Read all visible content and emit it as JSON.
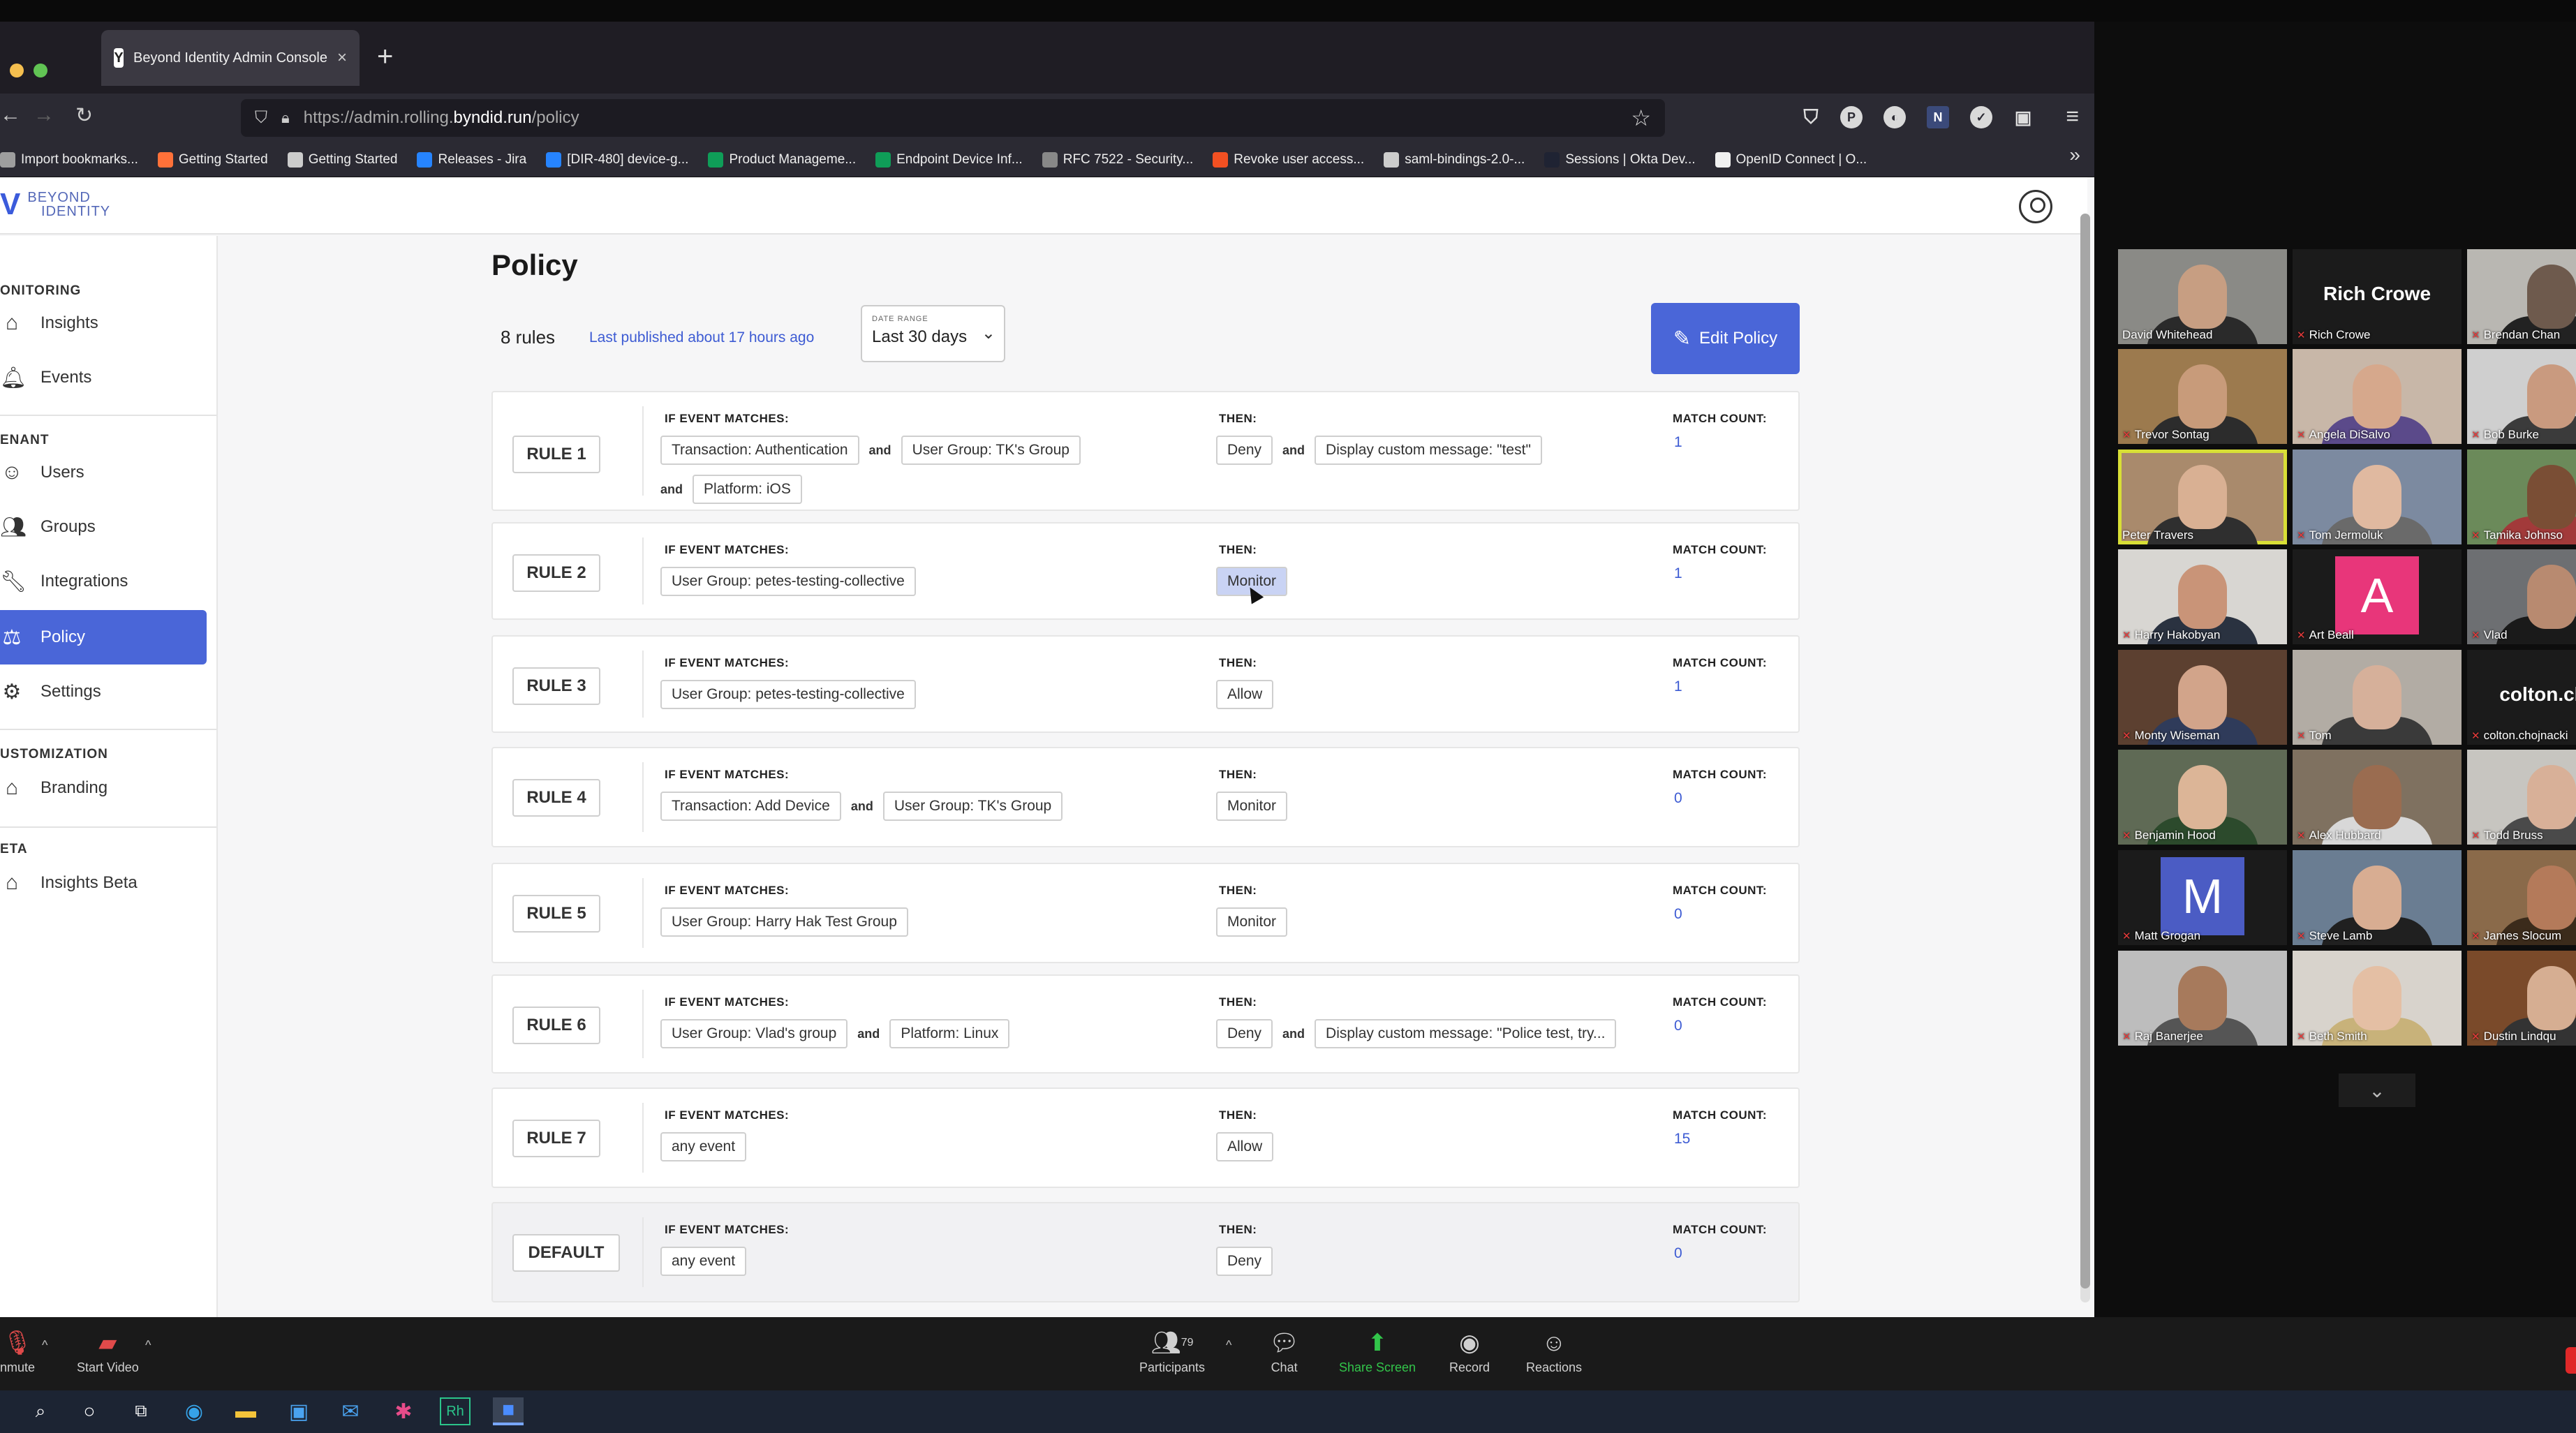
{
  "browser": {
    "tab_title": "Beyond Identity Admin Console",
    "tab_favicon": "Y",
    "tab_close": "×",
    "new_tab": "+",
    "url_prefix": "https://admin.rolling.",
    "url_host": "byndid.run",
    "url_path": "/policy",
    "bookmarks": [
      {
        "label": "Import bookmarks...",
        "icon": "folder-icon",
        "color": "#9e9e9e"
      },
      {
        "label": "Getting Started",
        "icon": "firefox-icon",
        "color": "#ff7139"
      },
      {
        "label": "Getting Started",
        "icon": "globe-icon",
        "color": "#cccccc"
      },
      {
        "label": "Releases - Jira",
        "icon": "jira-icon",
        "color": "#2684ff"
      },
      {
        "label": "[DIR-480] device-g...",
        "icon": "jira-icon",
        "color": "#2684ff"
      },
      {
        "label": "Product Manageme...",
        "icon": "sheet-icon",
        "color": "#0f9d58"
      },
      {
        "label": "Endpoint Device Inf...",
        "icon": "sheet-icon",
        "color": "#0f9d58"
      },
      {
        "label": "RFC 7522 - Security...",
        "icon": "rfc-icon",
        "color": "#888888"
      },
      {
        "label": "Revoke user access...",
        "icon": "windows-icon",
        "color": "#f25022"
      },
      {
        "label": "saml-bindings-2.0-...",
        "icon": "globe-icon",
        "color": "#cccccc"
      },
      {
        "label": "Sessions | Okta Dev...",
        "icon": "okta-icon",
        "color": "#1f2333"
      },
      {
        "label": "OpenID Connect | O...",
        "icon": "oidc-icon",
        "color": "#f0f0f0"
      }
    ]
  },
  "app": {
    "logo_line1": "BEYOND",
    "logo_line2": "IDENTITY",
    "sidebar": {
      "sections": [
        {
          "label": "ONITORING"
        },
        {
          "label": "ENANT"
        },
        {
          "label": "USTOMIZATION"
        },
        {
          "label": "ETA"
        }
      ],
      "items": [
        {
          "label": "Insights",
          "icon": "home-icon"
        },
        {
          "label": "Events",
          "icon": "bell-icon"
        },
        {
          "label": "Users",
          "icon": "user-icon"
        },
        {
          "label": "Groups",
          "icon": "group-icon"
        },
        {
          "label": "Integrations",
          "icon": "wrench-icon"
        },
        {
          "label": "Policy",
          "icon": "gavel-icon",
          "active": true
        },
        {
          "label": "Settings",
          "icon": "gear-icon"
        },
        {
          "label": "Branding",
          "icon": "home-icon"
        },
        {
          "label": "Insights Beta",
          "icon": "home-icon"
        }
      ]
    },
    "page": {
      "title": "Policy",
      "rules_count": "8 rules",
      "last_published": "Last published about 17 hours ago",
      "date_range_label": "DATE RANGE",
      "date_range_value": "Last 30 days",
      "edit_button": "Edit Policy",
      "if_label": "IF EVENT MATCHES:",
      "then_label": "THEN:",
      "match_label": "MATCH COUNT:",
      "and_word": "and"
    },
    "rules": [
      {
        "name": "RULE 1",
        "conditions": [
          "Transaction: Authentication",
          "User Group: TK's Group",
          "Platform: iOS"
        ],
        "actions": [
          "Deny",
          "Display custom message: \"test\""
        ],
        "match_count": "1"
      },
      {
        "name": "RULE 2",
        "conditions": [
          "User Group: petes-testing-collective"
        ],
        "actions": [
          "Monitor"
        ],
        "match_count": "1"
      },
      {
        "name": "RULE 3",
        "conditions": [
          "User Group: petes-testing-collective"
        ],
        "actions": [
          "Allow"
        ],
        "match_count": "1"
      },
      {
        "name": "RULE 4",
        "conditions": [
          "Transaction: Add Device",
          "User Group: TK's Group"
        ],
        "actions": [
          "Monitor"
        ],
        "match_count": "0"
      },
      {
        "name": "RULE 5",
        "conditions": [
          "User Group: Harry Hak Test Group"
        ],
        "actions": [
          "Monitor"
        ],
        "match_count": "0"
      },
      {
        "name": "RULE 6",
        "conditions": [
          "User Group: Vlad's group",
          "Platform: Linux"
        ],
        "actions": [
          "Deny",
          "Display custom message: \"Police test, try..."
        ],
        "match_count": "0"
      },
      {
        "name": "RULE 7",
        "conditions": [
          "any event"
        ],
        "actions": [
          "Allow"
        ],
        "match_count": "15"
      },
      {
        "name": "DEFAULT",
        "conditions": [
          "any event"
        ],
        "actions": [
          "Deny"
        ],
        "match_count": "0"
      }
    ]
  },
  "zoom": {
    "unmute": "nmute",
    "start_video": "Start Video",
    "participants": "Participants",
    "participants_count": "79",
    "chat": "Chat",
    "share_screen": "Share Screen",
    "record": "Record",
    "reactions": "Reactions",
    "participants_grid": [
      {
        "name": "David Whitehead",
        "muted": false,
        "tile": "video",
        "bg": "#8a8a86",
        "skin": "#c79e82",
        "shirt": "#2a2a2a"
      },
      {
        "name": "Rich Crowe",
        "muted": true,
        "tile": "name",
        "big": "Rich Crowe"
      },
      {
        "name": "Brendan Chan",
        "muted": true,
        "tile": "video",
        "bg": "#b9b7b2",
        "skin": "#6e5a4d",
        "shirt": "#222"
      },
      {
        "name": "Trevor Sontag",
        "muted": true,
        "tile": "video",
        "bg": "#9c7a4e",
        "skin": "#c89b7a",
        "shirt": "#2c2c2c"
      },
      {
        "name": "Angela DiSalvo",
        "muted": true,
        "tile": "video",
        "bg": "#c8b7a8",
        "skin": "#d6a88c",
        "shirt": "#5b4a8a"
      },
      {
        "name": "Bob Burke",
        "muted": true,
        "tile": "video",
        "bg": "#cfcfcf",
        "skin": "#c99a7f",
        "shirt": "#3b3b3b"
      },
      {
        "name": "Peter Travers",
        "muted": false,
        "tile": "video",
        "bg": "#a98a6c",
        "skin": "#d9b093",
        "shirt": "#2f2f2f",
        "speaking": true
      },
      {
        "name": "Tom Jermoluk",
        "muted": true,
        "tile": "video",
        "bg": "#7c8aa0",
        "skin": "#e0b9a0",
        "shirt": "#6a6a6a"
      },
      {
        "name": "Tamika Johnso",
        "muted": true,
        "tile": "video",
        "bg": "#6b8a5a",
        "skin": "#7a4e35",
        "shirt": "#a23a3a"
      },
      {
        "name": "Harry Hakobyan",
        "muted": true,
        "tile": "video",
        "bg": "#d8d6d2",
        "skin": "#c99478",
        "shirt": "#2a3240"
      },
      {
        "name": "Art Beall",
        "muted": true,
        "tile": "letter",
        "letter": "A",
        "color": "#e8367a"
      },
      {
        "name": "Vlad",
        "muted": true,
        "tile": "video",
        "bg": "#6d6f72",
        "skin": "#b88a70",
        "shirt": "#1a1a1a"
      },
      {
        "name": "Monty Wiseman",
        "muted": true,
        "tile": "video",
        "bg": "#5c4030",
        "skin": "#d2a48a",
        "shirt": "#2f3b5a"
      },
      {
        "name": "Tom",
        "muted": true,
        "tile": "video",
        "bg": "#b2aca4",
        "skin": "#d6b09a",
        "shirt": "#3a3a3a"
      },
      {
        "name": "colton.chojnacki",
        "muted": true,
        "tile": "name",
        "big": "colton.choj"
      },
      {
        "name": "Benjamin Hood",
        "muted": true,
        "tile": "video",
        "bg": "#5f6a55",
        "skin": "#dcb597",
        "shirt": "#2c4a2c"
      },
      {
        "name": "Alex Hubbard",
        "muted": true,
        "tile": "video",
        "bg": "#7f7160",
        "skin": "#9a6c50",
        "shirt": "#d8d8d8"
      },
      {
        "name": "Todd Bruss",
        "muted": true,
        "tile": "video",
        "bg": "#c7c5c0",
        "skin": "#d8b098",
        "shirt": "#4a4a4a"
      },
      {
        "name": "Matt Grogan",
        "muted": true,
        "tile": "letter",
        "letter": "M",
        "color": "#4b5cc4"
      },
      {
        "name": "Steve Lamb",
        "muted": true,
        "tile": "video",
        "bg": "#6a7d92",
        "skin": "#d8ad92",
        "shirt": "#202020"
      },
      {
        "name": "James Slocum",
        "muted": true,
        "tile": "video",
        "bg": "#8a6a4a",
        "skin": "#b47a5a",
        "shirt": "#3b2b1b"
      },
      {
        "name": "Raj Banerjee",
        "muted": true,
        "tile": "video",
        "bg": "#bdbdbd",
        "skin": "#a77a5c",
        "shirt": "#555"
      },
      {
        "name": "Beth Smith",
        "muted": true,
        "tile": "video",
        "bg": "#d8d3cc",
        "skin": "#e4bfa4",
        "shirt": "#c8b27a"
      },
      {
        "name": "Dustin Lindqu",
        "muted": true,
        "tile": "video",
        "bg": "#7a4a2a",
        "skin": "#d6ae92",
        "shirt": "#333"
      }
    ]
  }
}
